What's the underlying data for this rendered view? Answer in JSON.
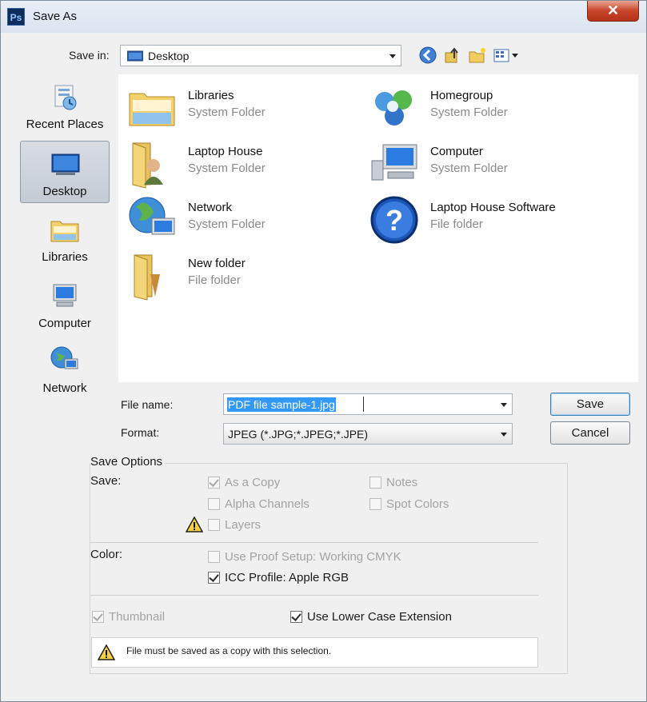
{
  "window": {
    "title": "Save As",
    "app_icon_text": "Ps",
    "close_glyph": "✕"
  },
  "toolbar": {
    "save_in_label": "Save in:",
    "save_in_value": "Desktop",
    "icons": [
      "back-icon",
      "up-folder-icon",
      "new-folder-icon",
      "view-menu-icon"
    ]
  },
  "places": [
    {
      "label": "Recent Places",
      "icon": "recent-places-icon"
    },
    {
      "label": "Desktop",
      "icon": "desktop-icon",
      "active": true
    },
    {
      "label": "Libraries",
      "icon": "libraries-icon"
    },
    {
      "label": "Computer",
      "icon": "computer-icon"
    },
    {
      "label": "Network",
      "icon": "network-icon"
    }
  ],
  "files": [
    {
      "name": "Libraries",
      "type": "System Folder",
      "icon": "libraries-folder-icon"
    },
    {
      "name": "Homegroup",
      "type": "System Folder",
      "icon": "homegroup-icon"
    },
    {
      "name": "Laptop House",
      "type": "System Folder",
      "icon": "user-folder-icon"
    },
    {
      "name": "Computer",
      "type": "System Folder",
      "icon": "computer-icon"
    },
    {
      "name": "Network",
      "type": "System Folder",
      "icon": "network-icon"
    },
    {
      "name": "Laptop House Software",
      "type": "File folder",
      "icon": "help-icon"
    },
    {
      "name": "New folder",
      "type": "File folder",
      "icon": "folder-icon"
    }
  ],
  "form": {
    "file_name_label": "File name:",
    "file_name_value": "PDF file sample-1.jpg",
    "format_label": "Format:",
    "format_value": "JPEG (*.JPG;*.JPEG;*.JPE)"
  },
  "buttons": {
    "save": "Save",
    "cancel": "Cancel"
  },
  "save_options": {
    "title": "Save Options",
    "save_label": "Save:",
    "as_a_copy": "As a Copy",
    "notes": "Notes",
    "alpha_channels": "Alpha Channels",
    "spot_colors": "Spot Colors",
    "layers": "Layers",
    "color_label": "Color:",
    "use_proof_setup": "Use Proof Setup:  Working CMYK",
    "icc_profile": "ICC Profile:  Apple RGB",
    "thumbnail": "Thumbnail",
    "lower_case_extension": "Use Lower Case Extension",
    "warning_message": "File must be saved as a copy with this selection."
  },
  "colors": {
    "selection": "#3399ff",
    "titlebar": "#dbe4ef",
    "close_button": "#c8452a"
  }
}
